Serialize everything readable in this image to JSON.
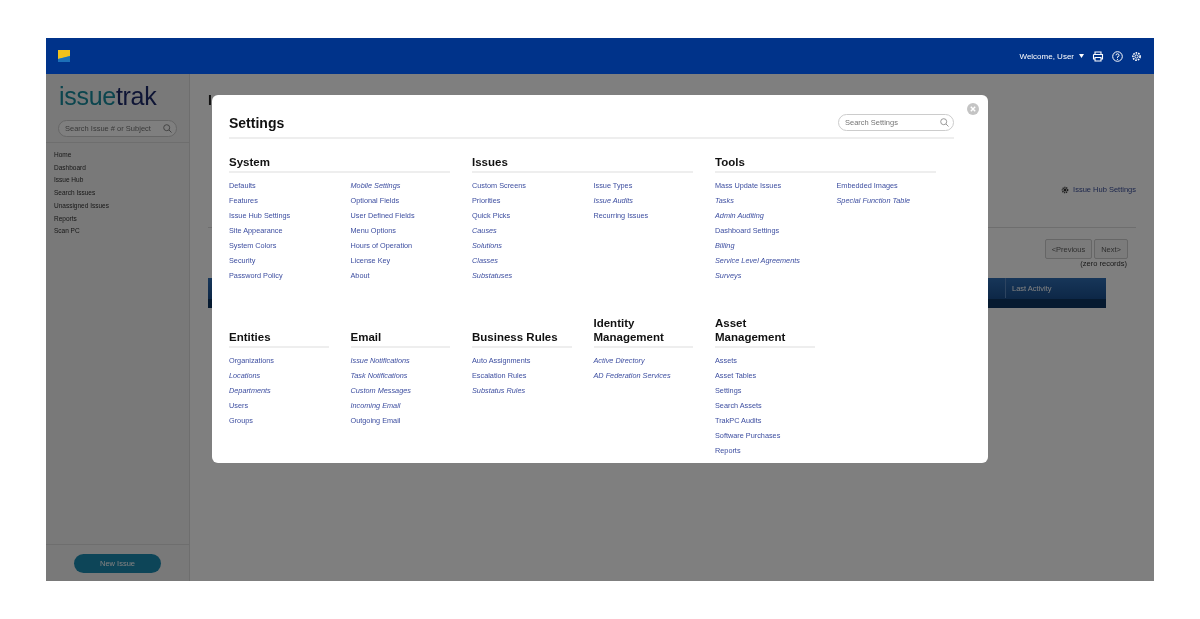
{
  "header": {
    "welcome": "Welcome, User"
  },
  "sidebar": {
    "logo_first": "issue",
    "logo_second": "trak",
    "search_placeholder": "Search Issue # or Subject",
    "items": [
      "Home",
      "Dashboard",
      "Issue Hub",
      "Search Issues",
      "Unassigned Issues",
      "Reports",
      "Scan PC"
    ],
    "new_issue_button": "New Issue"
  },
  "page": {
    "heading": "I",
    "hub_settings_link": "Issue Hub Settings",
    "previous_button": {
      "label": "<Previous",
      "disabled": true
    },
    "next_button": {
      "label": "Next>",
      "disabled": true
    },
    "record_count": "(zero records)",
    "table_columns": [
      "Last Activity"
    ]
  },
  "settings_dialog": {
    "title": "Settings",
    "search_placeholder": "Search Settings",
    "top_sections": [
      {
        "title": "System",
        "columns": [
          [
            {
              "label": "Defaults",
              "italic": false
            },
            {
              "label": "Features",
              "italic": false
            },
            {
              "label": "Issue Hub Settings",
              "italic": false
            },
            {
              "label": "Site Appearance",
              "italic": false
            },
            {
              "label": "System Colors",
              "italic": false
            },
            {
              "label": "Security",
              "italic": false
            },
            {
              "label": "Password Policy",
              "italic": false
            }
          ],
          [
            {
              "label": "Mobile Settings",
              "italic": true
            },
            {
              "label": "Optional Fields",
              "italic": false
            },
            {
              "label": "User Defined Fields",
              "italic": false
            },
            {
              "label": "Menu Options",
              "italic": false
            },
            {
              "label": "Hours of Operation",
              "italic": false
            },
            {
              "label": "License Key",
              "italic": false
            },
            {
              "label": "About",
              "italic": false
            }
          ]
        ]
      },
      {
        "title": "Issues",
        "columns": [
          [
            {
              "label": "Custom Screens",
              "italic": false
            },
            {
              "label": "Priorities",
              "italic": false
            },
            {
              "label": "Quick Picks",
              "italic": false
            },
            {
              "label": "Causes",
              "italic": true
            },
            {
              "label": "Solutions",
              "italic": true
            },
            {
              "label": "Classes",
              "italic": true
            },
            {
              "label": "Substatuses",
              "italic": true
            }
          ],
          [
            {
              "label": "Issue Types",
              "italic": false
            },
            {
              "label": "Issue Audits",
              "italic": true
            },
            {
              "label": "Recurring Issues",
              "italic": false
            }
          ]
        ]
      },
      {
        "title": "Tools",
        "columns": [
          [
            {
              "label": "Mass Update Issues",
              "italic": false
            },
            {
              "label": "Tasks",
              "italic": true
            },
            {
              "label": "Admin Auditing",
              "italic": true
            },
            {
              "label": "Dashboard Settings",
              "italic": false
            },
            {
              "label": "Billing",
              "italic": true
            },
            {
              "label": "Service Level Agreements",
              "italic": true
            },
            {
              "label": "Surveys",
              "italic": true
            }
          ],
          [
            {
              "label": "Embedded Images",
              "italic": false
            },
            {
              "label": "Special Function Table",
              "italic": true
            }
          ]
        ]
      }
    ],
    "bottom_sections": [
      {
        "title": "Entities",
        "columns": [
          [
            {
              "label": "Organizations",
              "italic": false
            },
            {
              "label": "Locations",
              "italic": true
            },
            {
              "label": "Departments",
              "italic": true
            },
            {
              "label": "Users",
              "italic": false
            },
            {
              "label": "Groups",
              "italic": false
            }
          ]
        ]
      },
      {
        "title": "Email",
        "columns": [
          [
            {
              "label": "Issue Notifications",
              "italic": true
            },
            {
              "label": "Task Notifications",
              "italic": true
            },
            {
              "label": "Custom Messages",
              "italic": true
            },
            {
              "label": "Incoming Email",
              "italic": true
            },
            {
              "label": "Outgoing Email",
              "italic": false
            }
          ]
        ]
      },
      {
        "title": "Business Rules",
        "columns": [
          [
            {
              "label": "Auto Assignments",
              "italic": false
            },
            {
              "label": "Escalation Rules",
              "italic": false
            },
            {
              "label": "Substatus Rules",
              "italic": true
            }
          ]
        ]
      },
      {
        "title": "Identity Management",
        "columns": [
          [
            {
              "label": "Active Directory",
              "italic": true
            },
            {
              "label": "AD Federation Services",
              "italic": true
            }
          ]
        ]
      },
      {
        "title": "Asset Management",
        "columns": [
          [
            {
              "label": "Assets",
              "italic": false
            },
            {
              "label": "Asset Tables",
              "italic": false
            },
            {
              "label": "Settings",
              "italic": false
            },
            {
              "label": "Search Assets",
              "italic": false
            },
            {
              "label": "TrakPC Audits",
              "italic": false
            },
            {
              "label": "Software Purchases",
              "italic": false
            },
            {
              "label": "Reports",
              "italic": false
            }
          ]
        ]
      }
    ]
  }
}
